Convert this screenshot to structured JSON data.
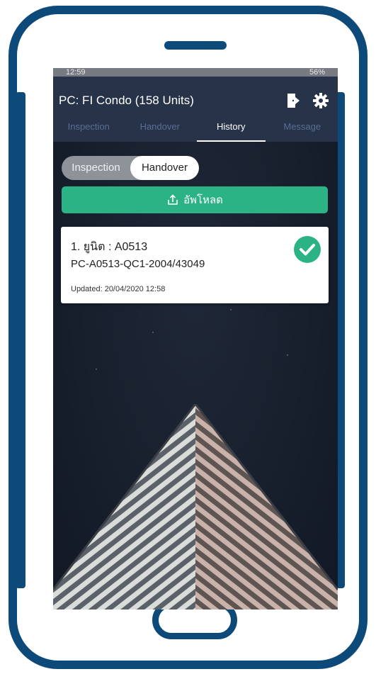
{
  "status_bar": {
    "time": "12:59",
    "right": "56%"
  },
  "header": {
    "title": "PC: FI Condo (158 Units)",
    "exit_icon": "exit-door-icon",
    "settings_icon": "gear-icon"
  },
  "tabs": [
    {
      "label": "Inspection",
      "active": false
    },
    {
      "label": "Handover",
      "active": false
    },
    {
      "label": "History",
      "active": true
    },
    {
      "label": "Message",
      "active": false
    }
  ],
  "toggle": {
    "options": [
      "Inspection",
      "Handover"
    ],
    "selected": "Handover"
  },
  "upload_button": {
    "label": "อัพโหลด",
    "icon": "upload-icon"
  },
  "history_items": [
    {
      "unit": "1. ยูนิต : A0513",
      "doc_no": "PC-A0513-QC1-2004/43049",
      "updated": "Updated: 20/04/2020 12:58",
      "status_icon": "check-circle-icon"
    }
  ],
  "colors": {
    "frame": "#0d4a7a",
    "app_bar": "#273349",
    "accent_green": "#2bb386",
    "background_dark": "#1b2332"
  }
}
